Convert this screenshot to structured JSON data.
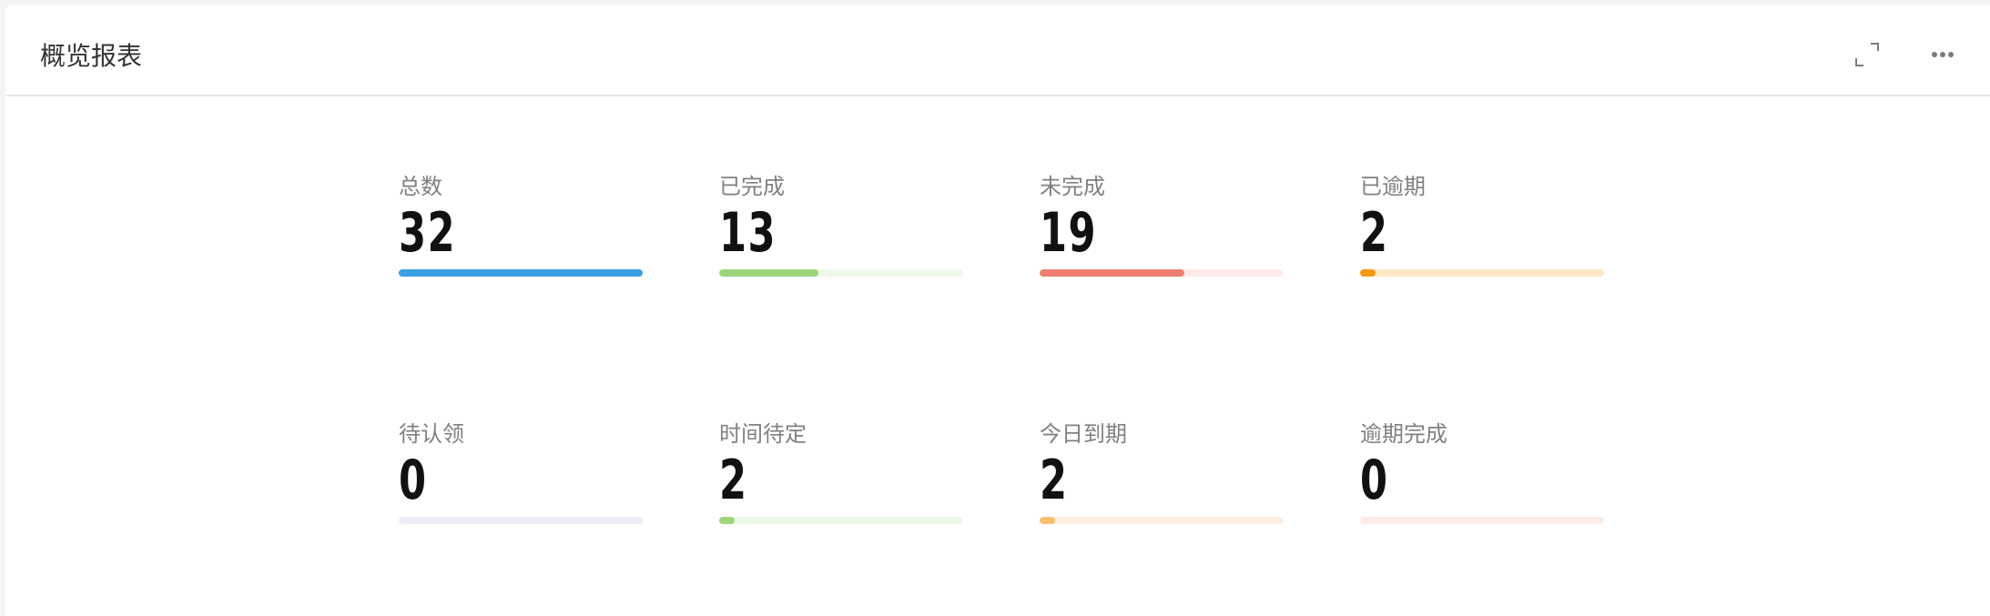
{
  "header": {
    "title": "概览报表",
    "expand_icon": "expand-icon",
    "more_icon": "more-horizontal-icon"
  },
  "stats": [
    {
      "label": "总数",
      "value": "32",
      "progress": 1.0,
      "bar_color": "#3a9fe4",
      "track_color": "#3a9fe4"
    },
    {
      "label": "已完成",
      "value": "13",
      "progress": 0.406,
      "bar_color": "#9dd679",
      "track_color": "#eef8e7"
    },
    {
      "label": "未完成",
      "value": "19",
      "progress": 0.594,
      "bar_color": "#ee7f70",
      "track_color": "#fdeaea"
    },
    {
      "label": "已逾期",
      "value": "2",
      "progress": 0.0625,
      "bar_color": "#f5990f",
      "track_color": "#fde8c5"
    },
    {
      "label": "待认领",
      "value": "0",
      "progress": 0.0,
      "bar_color": "#b9b4e0",
      "track_color": "#eeecf6"
    },
    {
      "label": "时间待定",
      "value": "2",
      "progress": 0.0625,
      "bar_color": "#9dd679",
      "track_color": "#eef8e7"
    },
    {
      "label": "今日到期",
      "value": "2",
      "progress": 0.0625,
      "bar_color": "#f9c16c",
      "track_color": "#fdeee2"
    },
    {
      "label": "逾期完成",
      "value": "0",
      "progress": 0.0,
      "bar_color": "#ee7f70",
      "track_color": "#fdeceb"
    }
  ]
}
